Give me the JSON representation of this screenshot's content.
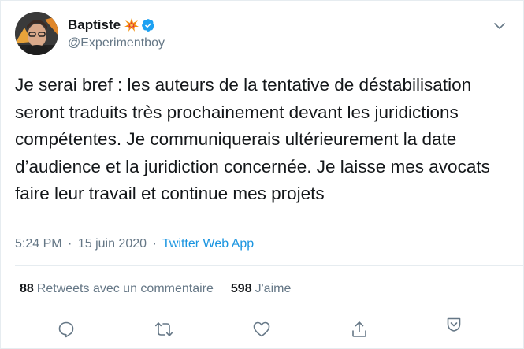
{
  "user": {
    "display_name": "Baptiste",
    "handle": "@Experimentboy",
    "name_emoji": "collision-emoji",
    "verified": true
  },
  "tweet": {
    "text": "Je serai bref : les auteurs de la tentative de déstabilisation seront traduits très prochainement devant les juridictions compétentes. Je communiquerais ultérieurement la date d’audience et la juridiction concernée. Je laisse mes avocats faire leur travail et continue mes projets",
    "time": "5:24 PM",
    "separator": "·",
    "date": "15 juin 2020",
    "source": "Twitter Web App"
  },
  "stats": {
    "retweets_count": "88",
    "retweets_label": "Retweets avec un commentaire",
    "likes_count": "598",
    "likes_label": "J'aime"
  },
  "actions": [
    "reply-icon",
    "retweet-icon",
    "like-icon",
    "share-icon",
    "save-icon"
  ],
  "colors": {
    "text": "#14171a",
    "secondary": "#657786",
    "link": "#1b95e0",
    "verified": "#1da1f2",
    "border": "#e6ecf0"
  }
}
